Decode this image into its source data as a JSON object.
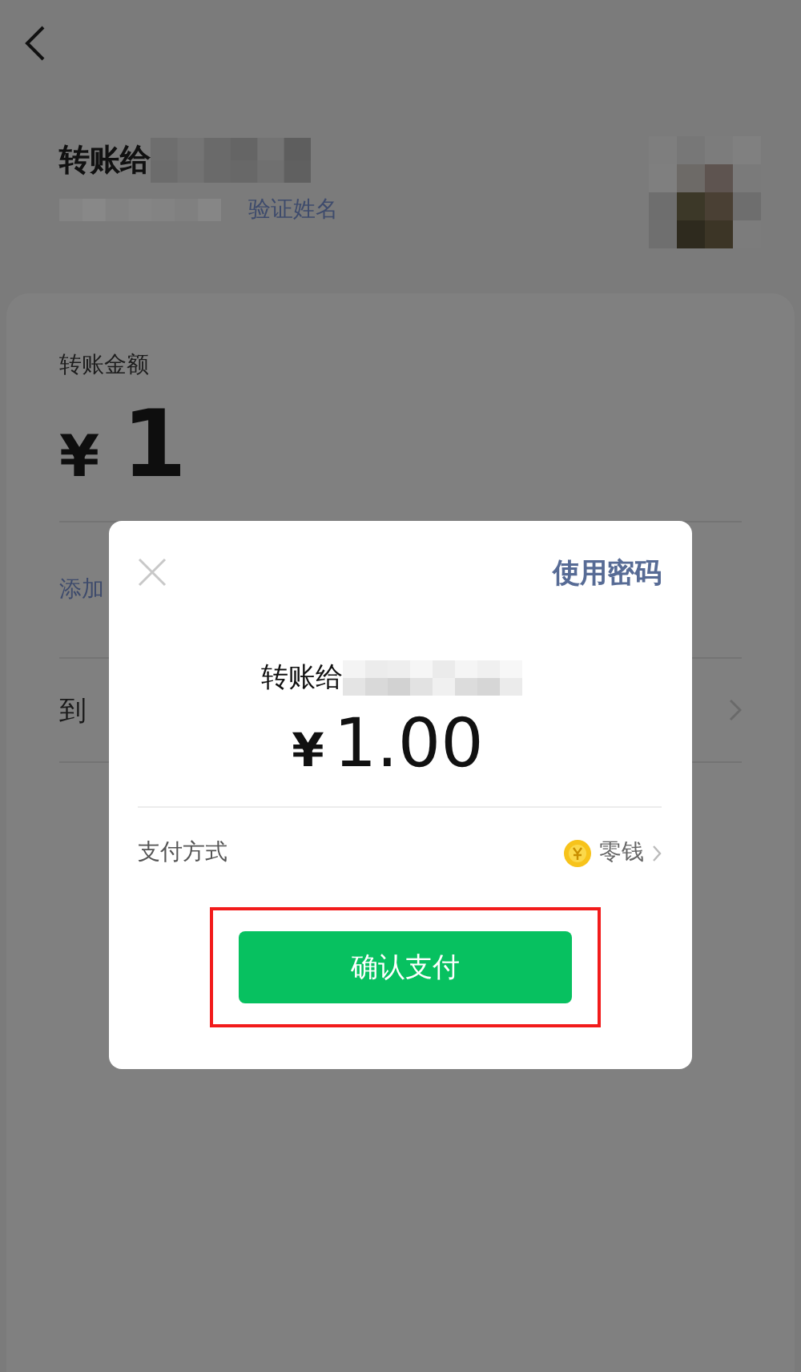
{
  "header": {
    "title": "转账给",
    "verify_link": "验证姓名"
  },
  "amount_card": {
    "label": "转账金额",
    "currency": "¥",
    "amount": "1",
    "remark_link": "添加",
    "arrival_label": "到"
  },
  "dialog": {
    "use_password": "使用密码",
    "recipient_label": "转账给",
    "currency": "¥",
    "amount": "1.00",
    "method_label": "支付方式",
    "method_value": "零钱",
    "confirm_button": "确认支付",
    "highlighted": true
  }
}
